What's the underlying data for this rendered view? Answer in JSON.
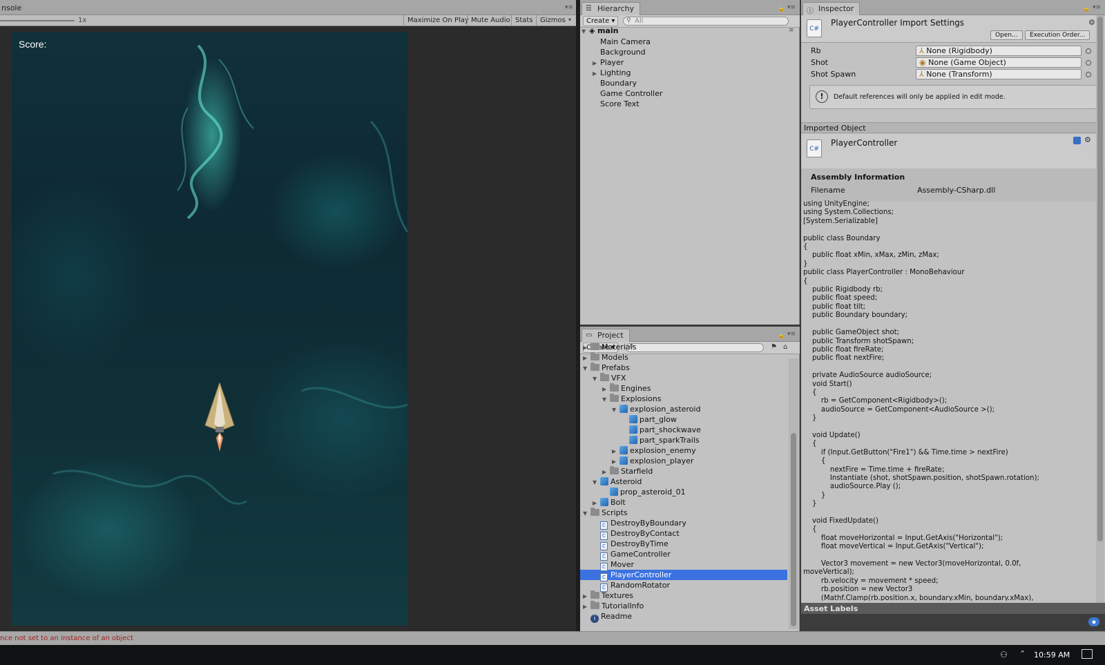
{
  "game": {
    "tab_label": "nsole",
    "scale_label": "1x",
    "toolbar": [
      "Maximize On Play",
      "Mute Audio",
      "Stats",
      "Gizmos"
    ],
    "score_label": "Score:"
  },
  "hierarchy": {
    "tab_label": "Hierarchy",
    "create_label": "Create",
    "search_placeholder": "All",
    "scene_name": "main",
    "items": [
      {
        "label": "Main Camera",
        "expandable": false
      },
      {
        "label": "Background",
        "expandable": false
      },
      {
        "label": "Player",
        "expandable": true
      },
      {
        "label": "Lighting",
        "expandable": true
      },
      {
        "label": "Boundary",
        "expandable": false
      },
      {
        "label": "Game Controller",
        "expandable": false
      },
      {
        "label": "Score Text",
        "expandable": false
      }
    ]
  },
  "project": {
    "tab_label": "Project",
    "create_label": "Create",
    "search_placeholder": "",
    "items": [
      {
        "label": "Materials",
        "depth": 0,
        "arrow": "right",
        "icon": "folder"
      },
      {
        "label": "Models",
        "depth": 0,
        "arrow": "right",
        "icon": "folder"
      },
      {
        "label": "Prefabs",
        "depth": 0,
        "arrow": "down",
        "icon": "folder"
      },
      {
        "label": "VFX",
        "depth": 1,
        "arrow": "down",
        "icon": "folder"
      },
      {
        "label": "Engines",
        "depth": 2,
        "arrow": "right",
        "icon": "folder"
      },
      {
        "label": "Explosions",
        "depth": 2,
        "arrow": "down",
        "icon": "folder"
      },
      {
        "label": "explosion_asteroid",
        "depth": 3,
        "arrow": "down",
        "icon": "prefab"
      },
      {
        "label": "part_glow",
        "depth": 4,
        "arrow": "",
        "icon": "prefab"
      },
      {
        "label": "part_shockwave",
        "depth": 4,
        "arrow": "",
        "icon": "prefab"
      },
      {
        "label": "part_sparkTrails",
        "depth": 4,
        "arrow": "",
        "icon": "prefab"
      },
      {
        "label": "explosion_enemy",
        "depth": 3,
        "arrow": "right",
        "icon": "prefab"
      },
      {
        "label": "explosion_player",
        "depth": 3,
        "arrow": "right",
        "icon": "prefab"
      },
      {
        "label": "Starfield",
        "depth": 2,
        "arrow": "right",
        "icon": "folder"
      },
      {
        "label": "Asteroid",
        "depth": 1,
        "arrow": "down",
        "icon": "prefab"
      },
      {
        "label": "prop_asteroid_01",
        "depth": 2,
        "arrow": "",
        "icon": "prefab"
      },
      {
        "label": "Bolt",
        "depth": 1,
        "arrow": "right",
        "icon": "prefab"
      },
      {
        "label": "Scripts",
        "depth": 0,
        "arrow": "down",
        "icon": "folder"
      },
      {
        "label": "DestroyByBoundary",
        "depth": 1,
        "arrow": "",
        "icon": "script"
      },
      {
        "label": "DestroyByContact",
        "depth": 1,
        "arrow": "",
        "icon": "script"
      },
      {
        "label": "DestroyByTime",
        "depth": 1,
        "arrow": "",
        "icon": "script"
      },
      {
        "label": "GameController",
        "depth": 1,
        "arrow": "",
        "icon": "script"
      },
      {
        "label": "Mover",
        "depth": 1,
        "arrow": "",
        "icon": "script"
      },
      {
        "label": "PlayerController",
        "depth": 1,
        "arrow": "",
        "icon": "script",
        "selected": true
      },
      {
        "label": "RandomRotator",
        "depth": 1,
        "arrow": "",
        "icon": "script"
      },
      {
        "label": "Textures",
        "depth": 0,
        "arrow": "right",
        "icon": "folder"
      },
      {
        "label": "TutorialInfo",
        "depth": 0,
        "arrow": "right",
        "icon": "folder"
      },
      {
        "label": "Readme",
        "depth": 0,
        "arrow": "",
        "icon": "info"
      }
    ]
  },
  "inspector": {
    "tab_label": "Inspector",
    "title": "PlayerController Import Settings",
    "open_label": "Open...",
    "exec_order_label": "Execution Order...",
    "fields": [
      {
        "label": "Rb",
        "value": "None (Rigidbody)"
      },
      {
        "label": "Shot",
        "value": "None (Game Object)"
      },
      {
        "label": "Shot Spawn",
        "value": "None (Transform)"
      }
    ],
    "warning": "Default references will only be applied in edit mode.",
    "imported_object_label": "Imported Object",
    "object_name": "PlayerController",
    "assembly_title": "Assembly Information",
    "filename_label": "Filename",
    "filename_value": "Assembly-CSharp.dll",
    "code": "using UnityEngine;\nusing System.Collections;\n[System.Serializable]\n\npublic class Boundary\n{\n    public float xMin, xMax, zMin, zMax;\n}\npublic class PlayerController : MonoBehaviour\n{\n    public Rigidbody rb;\n    public float speed;\n    public float tilt;\n    public Boundary boundary;\n\n    public GameObject shot;\n    public Transform shotSpawn;\n    public float fireRate;\n    public float nextFire;\n\n    private AudioSource audioSource;\n    void Start()\n    {\n        rb = GetComponent<Rigidbody>();\n        audioSource = GetComponent<AudioSource >();\n    }\n\n    void Update()\n    {\n        if (Input.GetButton(\"Fire1\") && Time.time > nextFire)\n        {\n            nextFire = Time.time + fireRate;\n            Instantiate (shot, shotSpawn.position, shotSpawn.rotation);\n            audioSource.Play ();\n        }\n    }\n\n    void FixedUpdate()\n    {\n        float moveHorizontal = Input.GetAxis(\"Horizontal\");\n        float moveVertical = Input.GetAxis(\"Vertical\");\n\n        Vector3 movement = new Vector3(moveHorizontal, 0.0f,\nmoveVertical);\n        rb.velocity = movement * speed;\n        rb.position = new Vector3\n        (Mathf.Clamp(rb.position.x, boundary.xMin, boundary.xMax),",
    "asset_labels": "Asset Labels"
  },
  "status": {
    "message": "nce not set to an instance of an object"
  },
  "taskbar": {
    "clock": "10:59 AM"
  },
  "colors": {
    "selection": "#3b72e0",
    "panel_bg": "#c2c2c2",
    "error_text": "#a02020"
  }
}
